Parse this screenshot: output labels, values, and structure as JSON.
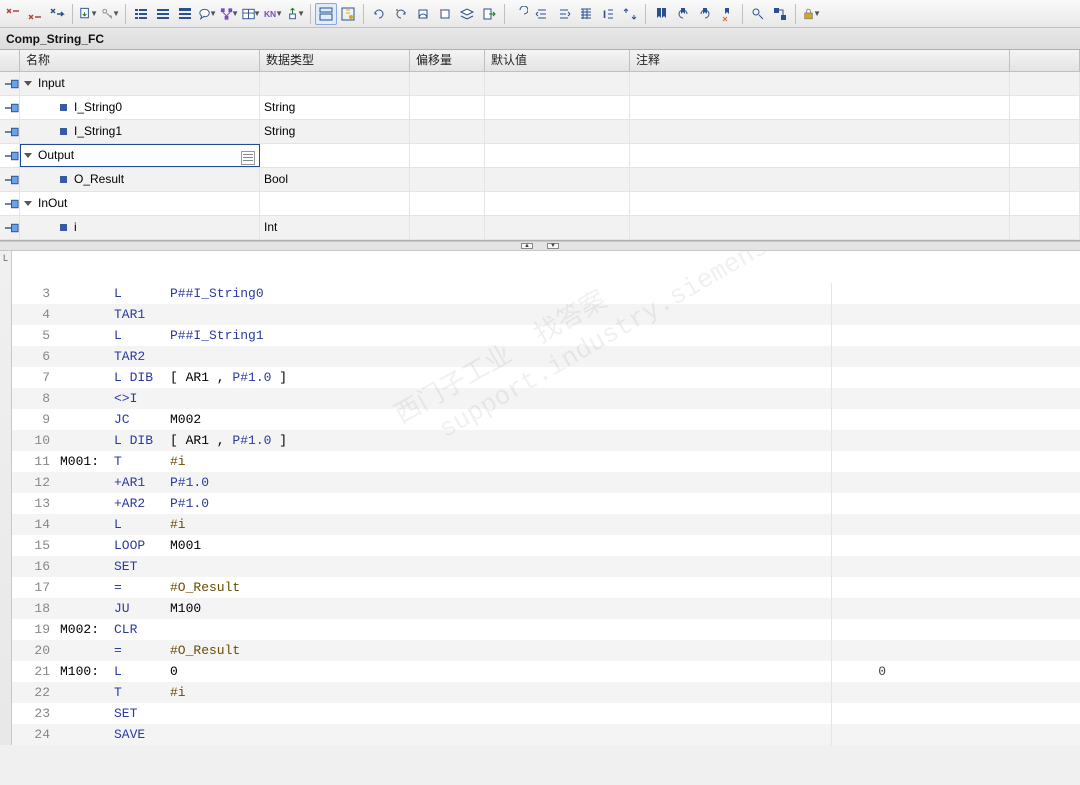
{
  "title": "Comp_String_FC",
  "columns": {
    "name": "名称",
    "dtype": "数据类型",
    "offset": "偏移量",
    "default": "默认值",
    "comment": "注释"
  },
  "vars": [
    {
      "kind": "section",
      "name": "Input",
      "dtype": "",
      "alt": true
    },
    {
      "kind": "var",
      "name": "I_String0",
      "dtype": "String",
      "alt": false
    },
    {
      "kind": "var",
      "name": "I_String1",
      "dtype": "String",
      "alt": true
    },
    {
      "kind": "section",
      "name": "Output",
      "dtype": "",
      "alt": false,
      "selected": true
    },
    {
      "kind": "var",
      "name": "O_Result",
      "dtype": "Bool",
      "alt": true
    },
    {
      "kind": "section",
      "name": "InOut",
      "dtype": "",
      "alt": false
    },
    {
      "kind": "var",
      "name": "i",
      "dtype": "Int",
      "alt": true
    }
  ],
  "code": [
    {
      "n": 3,
      "label": "",
      "op": "L",
      "arg_plain": "",
      "addr": "P##I_String0",
      "note": ""
    },
    {
      "n": 4,
      "label": "",
      "op": "TAR1",
      "arg_plain": "",
      "addr": "",
      "note": ""
    },
    {
      "n": 5,
      "label": "",
      "op": "L",
      "arg_plain": "",
      "addr": "P##I_String1",
      "note": ""
    },
    {
      "n": 6,
      "label": "",
      "op": "TAR2",
      "arg_plain": "",
      "addr": "",
      "note": ""
    },
    {
      "n": 7,
      "label": "",
      "op": "L DIB",
      "arg_plain": "[ AR1 , ",
      "addr": "P#1.0",
      "tail": " ]",
      "note": ""
    },
    {
      "n": 8,
      "label": "",
      "op": "<>I",
      "arg_plain": "",
      "addr": "",
      "note": ""
    },
    {
      "n": 9,
      "label": "",
      "op": "JC",
      "arg_plain": "M002",
      "addr": "",
      "note": ""
    },
    {
      "n": 10,
      "label": "",
      "op": "L DIB",
      "arg_plain": "[ AR1 , ",
      "addr": "P#1.0",
      "tail": " ]",
      "note": ""
    },
    {
      "n": 11,
      "label": "M001:",
      "op": "T",
      "arg_plain": "",
      "sym": "#i",
      "note": ""
    },
    {
      "n": 12,
      "label": "",
      "op": "+AR1",
      "arg_plain": "",
      "addr": "P#1.0",
      "note": ""
    },
    {
      "n": 13,
      "label": "",
      "op": "+AR2",
      "arg_plain": "",
      "addr": "P#1.0",
      "note": ""
    },
    {
      "n": 14,
      "label": "",
      "op": "L",
      "arg_plain": "",
      "sym": "#i",
      "note": ""
    },
    {
      "n": 15,
      "label": "",
      "op": "LOOP",
      "arg_plain": "M001",
      "addr": "",
      "note": ""
    },
    {
      "n": 16,
      "label": "",
      "op": "SET",
      "arg_plain": "",
      "addr": "",
      "note": ""
    },
    {
      "n": 17,
      "label": "",
      "op": "=",
      "arg_plain": "",
      "sym": "#O_Result",
      "note": ""
    },
    {
      "n": 18,
      "label": "",
      "op": "JU",
      "arg_plain": "M100",
      "addr": "",
      "note": ""
    },
    {
      "n": 19,
      "label": "M002:",
      "op": "CLR",
      "arg_plain": "",
      "addr": "",
      "note": ""
    },
    {
      "n": 20,
      "label": "",
      "op": "=",
      "arg_plain": "",
      "sym": "#O_Result",
      "note": ""
    },
    {
      "n": 21,
      "label": "M100:",
      "op": "L",
      "arg_plain": "0",
      "addr": "",
      "note": "0"
    },
    {
      "n": 22,
      "label": "",
      "op": "T",
      "arg_plain": "",
      "sym": "#i",
      "note": ""
    },
    {
      "n": 23,
      "label": "",
      "op": "SET",
      "arg_plain": "",
      "addr": "",
      "note": ""
    },
    {
      "n": 24,
      "label": "",
      "op": "SAVE",
      "arg_plain": "",
      "addr": "",
      "note": ""
    }
  ],
  "watermark": "西门子工业  找答案\n  support.industry.siemens.com/cs",
  "gutter_label": "L"
}
